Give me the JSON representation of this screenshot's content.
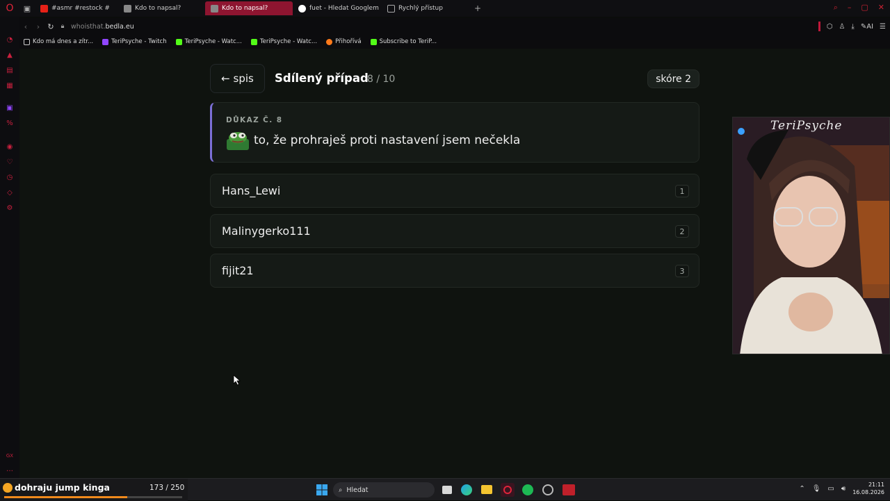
{
  "browser": {
    "tabs": [
      {
        "label": "#asmr #restock #",
        "active": false
      },
      {
        "label": "Kdo to napsal?",
        "active": false
      },
      {
        "label": "Kdo to napsal?",
        "active": true
      },
      {
        "label": "fuet - Hledat Googlem",
        "active": false
      },
      {
        "label": "Rychlý přístup",
        "active": false
      }
    ],
    "url_prefix": "whoisthat.",
    "url_domain": "bedla.eu",
    "ai_label": "AI",
    "bookmarks": [
      {
        "label": "Kdo má dnes a zítr...",
        "color": "#cccccc"
      },
      {
        "label": "TeriPsyche - Twitch",
        "color": "#9146ff"
      },
      {
        "label": "TeriPsyche - Watc...",
        "color": "#53fc18"
      },
      {
        "label": "TeriPsyche - Watc...",
        "color": "#53fc18"
      },
      {
        "label": "Přihořívá",
        "color": "#ff7a1a"
      },
      {
        "label": "Subscribe to TeriP...",
        "color": "#53fc18"
      }
    ]
  },
  "game": {
    "back_label": "← spis",
    "title": "Sdílený případ",
    "progress": "8 / 10",
    "score_label": "skóre 2",
    "evidence_label": "DŮKAZ Č. 8",
    "evidence_text": "to, že prohraješ proti nastavení jsem nečekla",
    "answers": [
      {
        "name": "Hans_Lewi",
        "key": "1"
      },
      {
        "name": "Malinygerko111",
        "key": "2"
      },
      {
        "name": "fijit21",
        "key": "3"
      }
    ]
  },
  "webcam": {
    "streamer_name": "TeriPsyche"
  },
  "stream_goal": {
    "text": "dohraju jump kinga",
    "count": "173 / 250",
    "fraction": 0.692
  },
  "taskbar": {
    "search_placeholder": "Hledat",
    "time": "21:11",
    "date": "16.08.2026"
  },
  "colors": {
    "accent": "#8e1530",
    "evidence_border": "#7b6fd6",
    "goal_fill": "#f08a1c"
  }
}
